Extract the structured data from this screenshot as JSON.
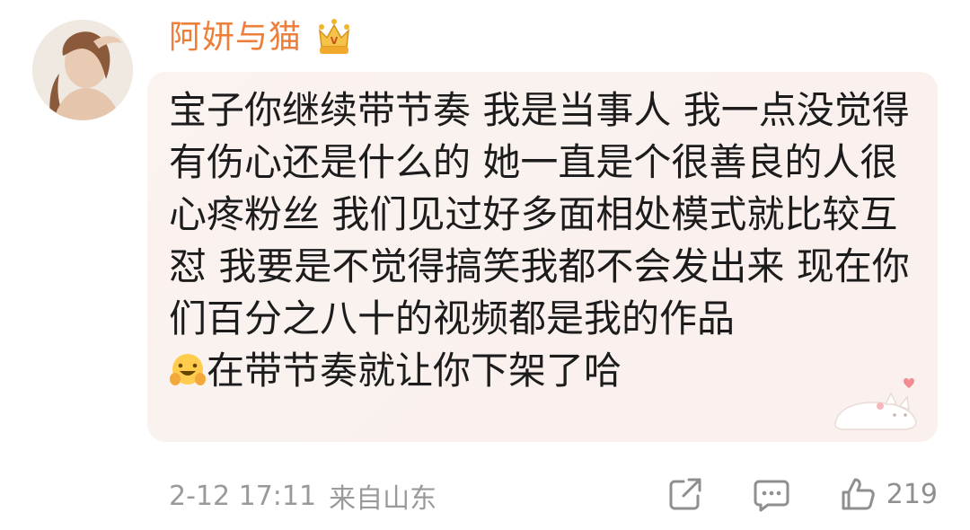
{
  "user": {
    "name": "阿妍与猫",
    "badge_icon": "crown-vip-icon"
  },
  "comment": {
    "text_main": "宝子你继续带节奏 我是当事人 我一点没觉得有伤心还是什么的 她一直是个很善良的人很心疼粉丝 我们见过好多面相处模式就比较互怼 我要是不觉得搞笑我都不会发出来 现在你们百分之八十的视频都是我的作品",
    "emoji": "smiling-face-with-open-hands-emoji",
    "text_tail": "在带节奏就让你下架了哈"
  },
  "meta": {
    "time": "2-12 17:11",
    "location": "来自山东"
  },
  "actions": {
    "share_icon": "share-icon",
    "comment_icon": "comment-icon",
    "like_icon": "thumbs-up-icon",
    "like_count": "219"
  },
  "colors": {
    "username": "#ee7f3a",
    "bubble_bg": "#fbf2ef",
    "meta_text": "#9a9a9a"
  }
}
